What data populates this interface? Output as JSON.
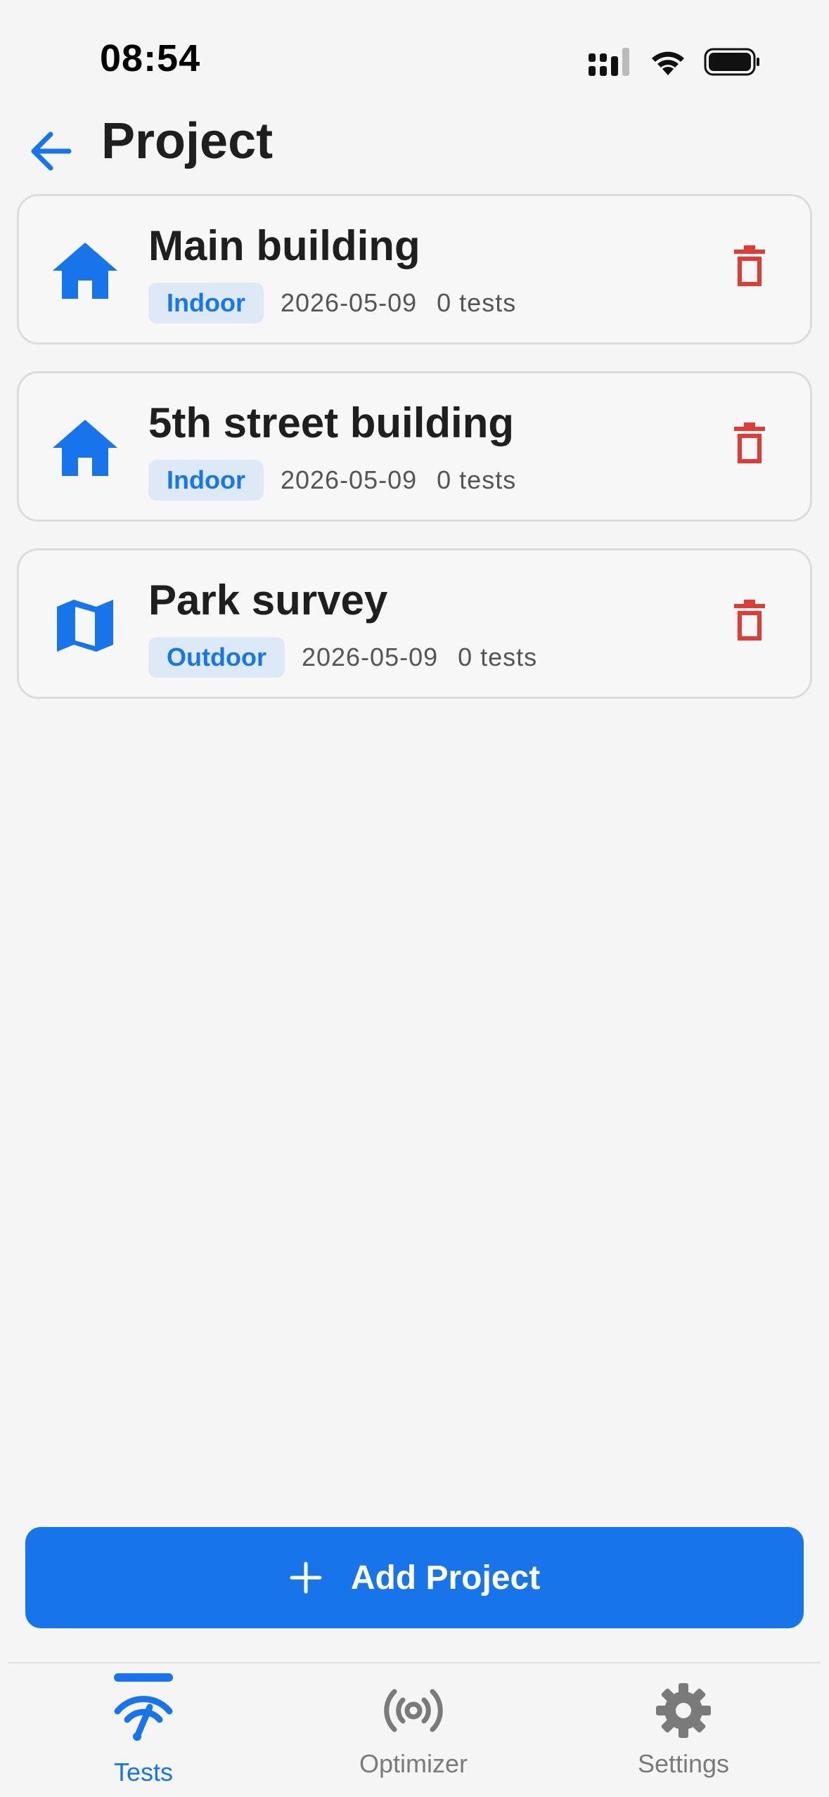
{
  "status_bar": {
    "time": "08:54"
  },
  "header": {
    "title": "Project"
  },
  "projects": [
    {
      "name": "Main building",
      "type": "Indoor",
      "date": "2026-05-09",
      "tests": "0 tests",
      "icon": "home-icon"
    },
    {
      "name": "5th street building",
      "type": "Indoor",
      "date": "2026-05-09",
      "tests": "0 tests",
      "icon": "home-icon"
    },
    {
      "name": "Park survey",
      "type": "Outdoor",
      "date": "2026-05-09",
      "tests": "0 tests",
      "icon": "map-icon"
    }
  ],
  "add_button": {
    "label": "Add Project"
  },
  "tabs": [
    {
      "label": "Tests",
      "active": true,
      "icon": "speedometer-wifi-icon"
    },
    {
      "label": "Optimizer",
      "active": false,
      "icon": "broadcast-icon"
    },
    {
      "label": "Settings",
      "active": false,
      "icon": "gear-icon"
    }
  ],
  "colors": {
    "accent": "#1874ea",
    "delete": "#e23b33",
    "inactive": "#7a7a7a"
  }
}
